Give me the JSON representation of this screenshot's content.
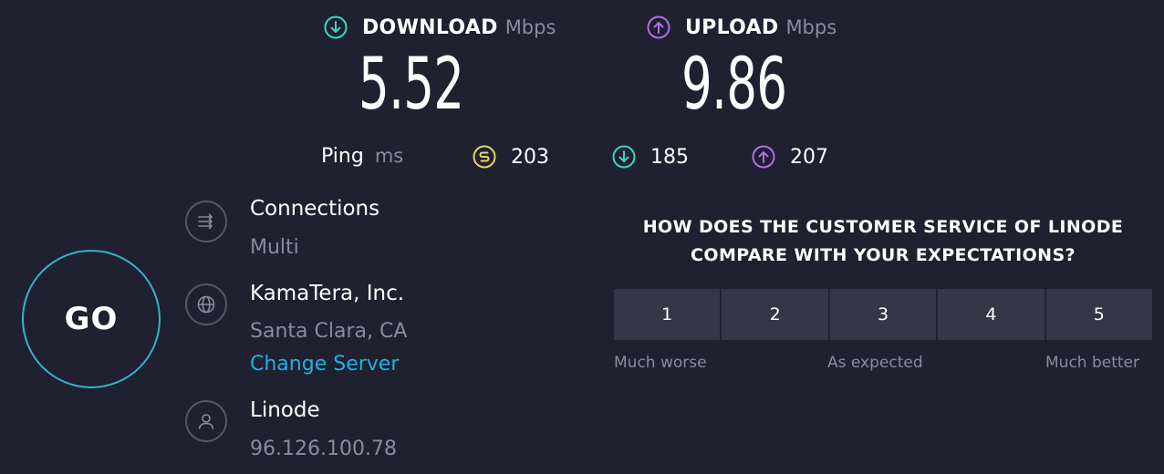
{
  "download": {
    "label": "DOWNLOAD",
    "unit": "Mbps",
    "value": "5.52",
    "icon": "download-arrow-icon",
    "color": "#3bd5c3"
  },
  "upload": {
    "label": "UPLOAD",
    "unit": "Mbps",
    "value": "9.86",
    "icon": "upload-arrow-icon",
    "color": "#b46ee8"
  },
  "ping": {
    "label": "Ping",
    "unit": "ms",
    "idle": {
      "value": "203",
      "icon": "ping-idle-icon",
      "color": "#e3d85e"
    },
    "download": {
      "value": "185",
      "icon": "download-arrow-icon",
      "color": "#3bd5c3"
    },
    "upload": {
      "value": "207",
      "icon": "upload-arrow-icon",
      "color": "#b46ee8"
    }
  },
  "go_button": {
    "label": "GO",
    "ring_color": "#37b3c7"
  },
  "connections": {
    "title": "Connections",
    "value": "Multi",
    "icon": "connections-icon"
  },
  "server": {
    "name": "KamaTera, Inc.",
    "location": "Santa Clara, CA",
    "change_label": "Change Server",
    "icon": "globe-icon",
    "link_color": "#1fb4e0"
  },
  "provider": {
    "name": "Linode",
    "ip": "96.126.100.78",
    "icon": "user-icon"
  },
  "survey": {
    "question_line1": "HOW DOES THE CUSTOMER SERVICE OF LINODE",
    "question_line2": "COMPARE WITH YOUR EXPECTATIONS?",
    "options": [
      "1",
      "2",
      "3",
      "4",
      "5"
    ],
    "label_low": "Much worse",
    "label_mid": "As expected",
    "label_high": "Much better"
  }
}
